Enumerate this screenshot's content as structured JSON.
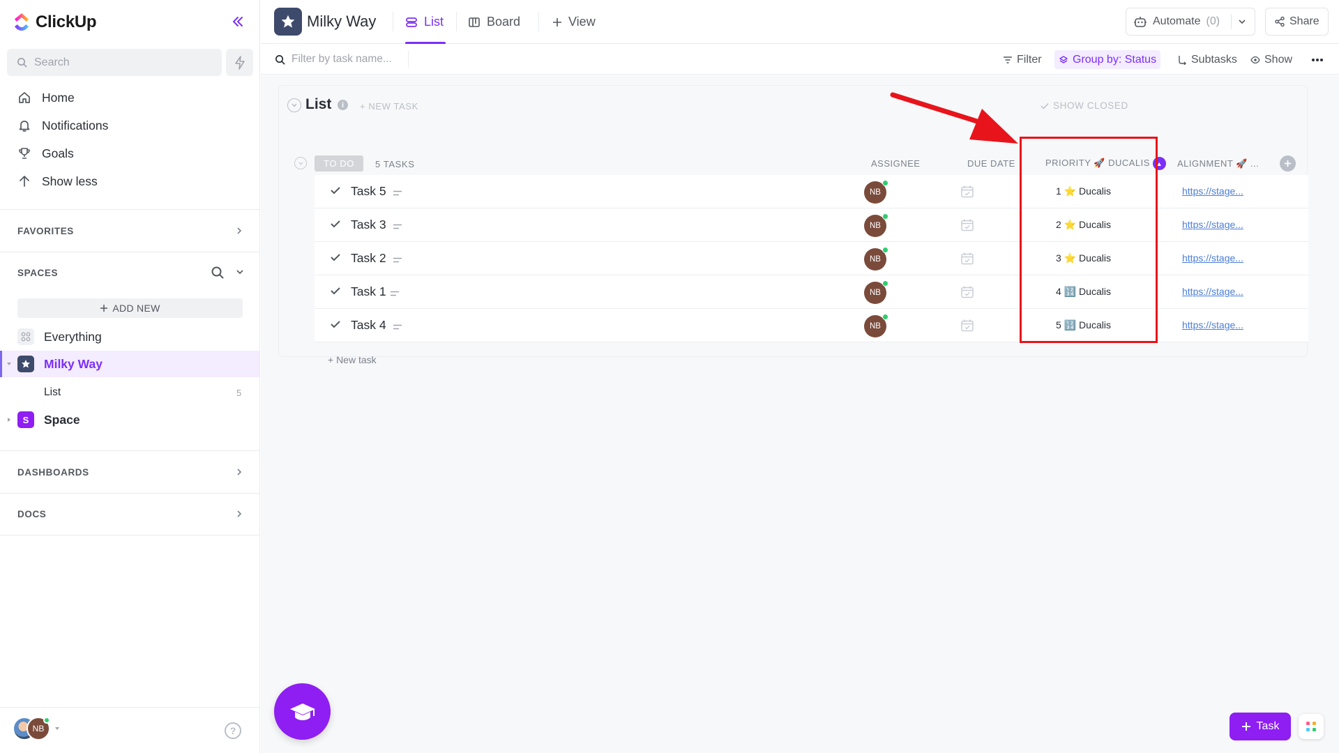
{
  "app": {
    "name": "ClickUp"
  },
  "sidebar": {
    "search_placeholder": "Search",
    "nav": [
      {
        "label": "Home",
        "icon": "home-icon"
      },
      {
        "label": "Notifications",
        "icon": "bell-icon"
      },
      {
        "label": "Goals",
        "icon": "trophy-icon"
      },
      {
        "label": "Show less",
        "icon": "arrow-up-icon"
      }
    ],
    "favorites_label": "FAVORITES",
    "spaces_label": "SPACES",
    "add_new_label": "ADD NEW",
    "everything_label": "Everything",
    "active_space": {
      "label": "Milky Way",
      "icon": "star-icon"
    },
    "list_item": {
      "label": "List",
      "count": "5"
    },
    "other_space": {
      "label": "Space",
      "badge": "S"
    },
    "dashboards_label": "DASHBOARDS",
    "docs_label": "DOCS",
    "user_initials": "NB"
  },
  "header": {
    "workspace_title": "Milky Way",
    "tabs": [
      {
        "label": "List",
        "active": true
      },
      {
        "label": "Board",
        "active": false
      },
      {
        "label": "View",
        "active": false
      }
    ],
    "automate_label": "Automate",
    "automate_count": "(0)",
    "share_label": "Share"
  },
  "toolbar": {
    "filter_placeholder": "Filter by task name...",
    "filter_label": "Filter",
    "group_label": "Group by: Status",
    "subtasks_label": "Subtasks",
    "show_label": "Show"
  },
  "list": {
    "title": "List",
    "new_task_label": "+ NEW TASK",
    "show_closed_label": "SHOW CLOSED",
    "status": "TO DO",
    "task_count": "5 TASKS",
    "columns": {
      "assignee": "ASSIGNEE",
      "due_date": "DUE DATE",
      "priority": "PRIORITY 🚀 DUCALIS",
      "alignment": "ALIGNMENT 🚀 ..."
    },
    "tasks": [
      {
        "name": "Task 5",
        "assignee": "NB",
        "priority": "1 ⭐ Ducalis",
        "link": "https://stage..."
      },
      {
        "name": "Task 3",
        "assignee": "NB",
        "priority": "2 ⭐ Ducalis",
        "link": "https://stage..."
      },
      {
        "name": "Task 2",
        "assignee": "NB",
        "priority": "3 ⭐ Ducalis",
        "link": "https://stage..."
      },
      {
        "name": "Task 1",
        "assignee": "NB",
        "priority": "4 🔢 Ducalis",
        "link": "https://stage..."
      },
      {
        "name": "Task 4",
        "assignee": "NB",
        "priority": "5 🔢 Ducalis",
        "link": "https://stage..."
      }
    ],
    "new_task_row": "+ New task"
  },
  "footer": {
    "add_task_label": "Task"
  },
  "colors": {
    "accent": "#7b2ff7",
    "fab": "#8e1ef2",
    "highlight": "#e8141b",
    "online": "#2ecd6f"
  }
}
